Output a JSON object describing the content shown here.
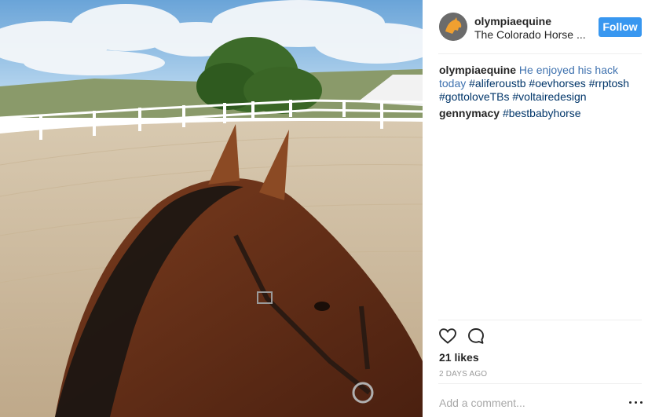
{
  "post": {
    "photo_alt": "",
    "icons": {
      "like": "heart-outline-icon",
      "comment": "speech-bubble-icon",
      "more": "more-options-icon"
    },
    "colors": {
      "follow_button": "#3897f0",
      "hashtag": "#003569",
      "muted": "#999999"
    }
  },
  "header": {
    "username": "olympiaequine",
    "location": "The Colorado Horse ...",
    "follow_label": "Follow"
  },
  "caption": {
    "author": "olympiaequine",
    "lead_text": "He enjoyed his hack today",
    "hashtags": [
      "#aliferoustb",
      "#oevhorses",
      "#rrptosh",
      "#gottoloveTBs",
      "#voltairedesign"
    ]
  },
  "comments": [
    {
      "author": "gennymacy",
      "hashtag": "#bestbabyhorse"
    }
  ],
  "meta": {
    "likes": "21 likes",
    "timestamp": "2 DAYS AGO"
  },
  "add_comment": {
    "placeholder": "Add a comment..."
  }
}
